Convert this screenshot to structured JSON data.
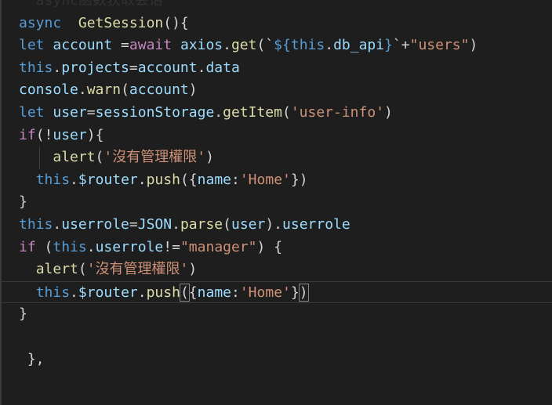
{
  "editor": {
    "lines": [
      {
        "indent": "",
        "tokens": [
          {
            "t": "  ",
            "c": "c-default"
          },
          {
            "t": "async",
            "c": "c-faded"
          },
          {
            "t": "函数获取会话",
            "c": "c-faded"
          }
        ]
      },
      {
        "indent": "",
        "tokens": [
          {
            "t": "async",
            "c": "c-kw"
          },
          {
            "t": "  ",
            "c": "c-default"
          },
          {
            "t": "GetSession",
            "c": "c-fn"
          },
          {
            "t": "(){",
            "c": "c-default"
          }
        ]
      },
      {
        "indent": "",
        "tokens": [
          {
            "t": "let",
            "c": "c-kw"
          },
          {
            "t": " ",
            "c": "c-default"
          },
          {
            "t": "account",
            "c": "c-var"
          },
          {
            "t": " =",
            "c": "c-default"
          },
          {
            "t": "await",
            "c": "c-ctrl"
          },
          {
            "t": " ",
            "c": "c-default"
          },
          {
            "t": "axios",
            "c": "c-var"
          },
          {
            "t": ".",
            "c": "c-default"
          },
          {
            "t": "get",
            "c": "c-fn"
          },
          {
            "t": "(`",
            "c": "c-default"
          },
          {
            "t": "${",
            "c": "c-tpl"
          },
          {
            "t": "this",
            "c": "c-kw"
          },
          {
            "t": ".",
            "c": "c-default"
          },
          {
            "t": "db_api",
            "c": "c-var"
          },
          {
            "t": "}",
            "c": "c-tpl"
          },
          {
            "t": "`+",
            "c": "c-default"
          },
          {
            "t": "\"users\"",
            "c": "c-str"
          },
          {
            "t": ")",
            "c": "c-default"
          }
        ]
      },
      {
        "indent": "",
        "tokens": [
          {
            "t": "this",
            "c": "c-kw"
          },
          {
            "t": ".",
            "c": "c-default"
          },
          {
            "t": "projects",
            "c": "c-var"
          },
          {
            "t": "=",
            "c": "c-default"
          },
          {
            "t": "account",
            "c": "c-var"
          },
          {
            "t": ".",
            "c": "c-default"
          },
          {
            "t": "data",
            "c": "c-var"
          }
        ]
      },
      {
        "indent": "",
        "tokens": [
          {
            "t": "console",
            "c": "c-var"
          },
          {
            "t": ".",
            "c": "c-default"
          },
          {
            "t": "warn",
            "c": "c-fn"
          },
          {
            "t": "(",
            "c": "c-default"
          },
          {
            "t": "account",
            "c": "c-var"
          },
          {
            "t": ")",
            "c": "c-default"
          }
        ]
      },
      {
        "indent": "",
        "tokens": [
          {
            "t": "let",
            "c": "c-kw"
          },
          {
            "t": " ",
            "c": "c-default"
          },
          {
            "t": "user",
            "c": "c-var"
          },
          {
            "t": "=",
            "c": "c-default"
          },
          {
            "t": "sessionStorage",
            "c": "c-var"
          },
          {
            "t": ".",
            "c": "c-default"
          },
          {
            "t": "getItem",
            "c": "c-fn"
          },
          {
            "t": "(",
            "c": "c-default"
          },
          {
            "t": "'user-info'",
            "c": "c-str"
          },
          {
            "t": ")",
            "c": "c-default"
          }
        ]
      },
      {
        "indent": "",
        "tokens": [
          {
            "t": "if",
            "c": "c-ctrl"
          },
          {
            "t": "(!",
            "c": "c-default"
          },
          {
            "t": "user",
            "c": "c-var"
          },
          {
            "t": "){",
            "c": "c-default"
          }
        ]
      },
      {
        "indent": "guide",
        "tokens": [
          {
            "t": "    ",
            "c": "c-default"
          },
          {
            "t": "alert",
            "c": "c-fn"
          },
          {
            "t": "(",
            "c": "c-default"
          },
          {
            "t": "'沒有管理權限'",
            "c": "c-str"
          },
          {
            "t": ")",
            "c": "c-default"
          }
        ]
      },
      {
        "indent": "",
        "tokens": [
          {
            "t": "  ",
            "c": "c-default"
          },
          {
            "t": "this",
            "c": "c-kw"
          },
          {
            "t": ".",
            "c": "c-default"
          },
          {
            "t": "$router",
            "c": "c-var"
          },
          {
            "t": ".",
            "c": "c-default"
          },
          {
            "t": "push",
            "c": "c-fn"
          },
          {
            "t": "({",
            "c": "c-default"
          },
          {
            "t": "name",
            "c": "c-var"
          },
          {
            "t": ":",
            "c": "c-default"
          },
          {
            "t": "'Home'",
            "c": "c-str"
          },
          {
            "t": "})",
            "c": "c-default"
          }
        ]
      },
      {
        "indent": "",
        "tokens": [
          {
            "t": "}",
            "c": "c-default"
          }
        ]
      },
      {
        "indent": "",
        "tokens": [
          {
            "t": "this",
            "c": "c-kw"
          },
          {
            "t": ".",
            "c": "c-default"
          },
          {
            "t": "userrole",
            "c": "c-var"
          },
          {
            "t": "=",
            "c": "c-default"
          },
          {
            "t": "JSON",
            "c": "c-var"
          },
          {
            "t": ".",
            "c": "c-default"
          },
          {
            "t": "parse",
            "c": "c-fn"
          },
          {
            "t": "(",
            "c": "c-default"
          },
          {
            "t": "user",
            "c": "c-var"
          },
          {
            "t": ").",
            "c": "c-default"
          },
          {
            "t": "userrole",
            "c": "c-var"
          }
        ]
      },
      {
        "indent": "",
        "tokens": [
          {
            "t": "if",
            "c": "c-ctrl"
          },
          {
            "t": " (",
            "c": "c-default"
          },
          {
            "t": "this",
            "c": "c-kw"
          },
          {
            "t": ".",
            "c": "c-default"
          },
          {
            "t": "userrole",
            "c": "c-var"
          },
          {
            "t": "!=",
            "c": "c-default"
          },
          {
            "t": "\"manager\"",
            "c": "c-str"
          },
          {
            "t": ") {",
            "c": "c-default"
          }
        ]
      },
      {
        "indent": "",
        "tokens": [
          {
            "t": "  ",
            "c": "c-default"
          },
          {
            "t": "alert",
            "c": "c-fn"
          },
          {
            "t": "(",
            "c": "c-default"
          },
          {
            "t": "'沒有管理權限'",
            "c": "c-str"
          },
          {
            "t": ")",
            "c": "c-default"
          }
        ]
      },
      {
        "indent": "current",
        "tokens": [
          {
            "t": "  ",
            "c": "c-default"
          },
          {
            "t": "this",
            "c": "c-kw"
          },
          {
            "t": ".",
            "c": "c-default"
          },
          {
            "t": "$router",
            "c": "c-var"
          },
          {
            "t": ".",
            "c": "c-default"
          },
          {
            "t": "push",
            "c": "c-fn"
          },
          {
            "t": "(",
            "c": "c-default bracket-box"
          },
          {
            "t": "{",
            "c": "c-default"
          },
          {
            "t": "name",
            "c": "c-var"
          },
          {
            "t": ":",
            "c": "c-default"
          },
          {
            "t": "'Home'",
            "c": "c-str"
          },
          {
            "t": "}",
            "c": "c-default"
          },
          {
            "t": ")",
            "c": "c-default bracket-box"
          }
        ]
      },
      {
        "indent": "",
        "tokens": [
          {
            "t": "}",
            "c": "c-default"
          }
        ]
      },
      {
        "indent": "",
        "tokens": [
          {
            "t": "",
            "c": "c-default"
          }
        ]
      },
      {
        "indent": "",
        "tokens": [
          {
            "t": " },",
            "c": "c-default"
          }
        ]
      },
      {
        "indent": "",
        "tokens": [
          {
            "t": "",
            "c": "c-default"
          }
        ]
      }
    ]
  }
}
